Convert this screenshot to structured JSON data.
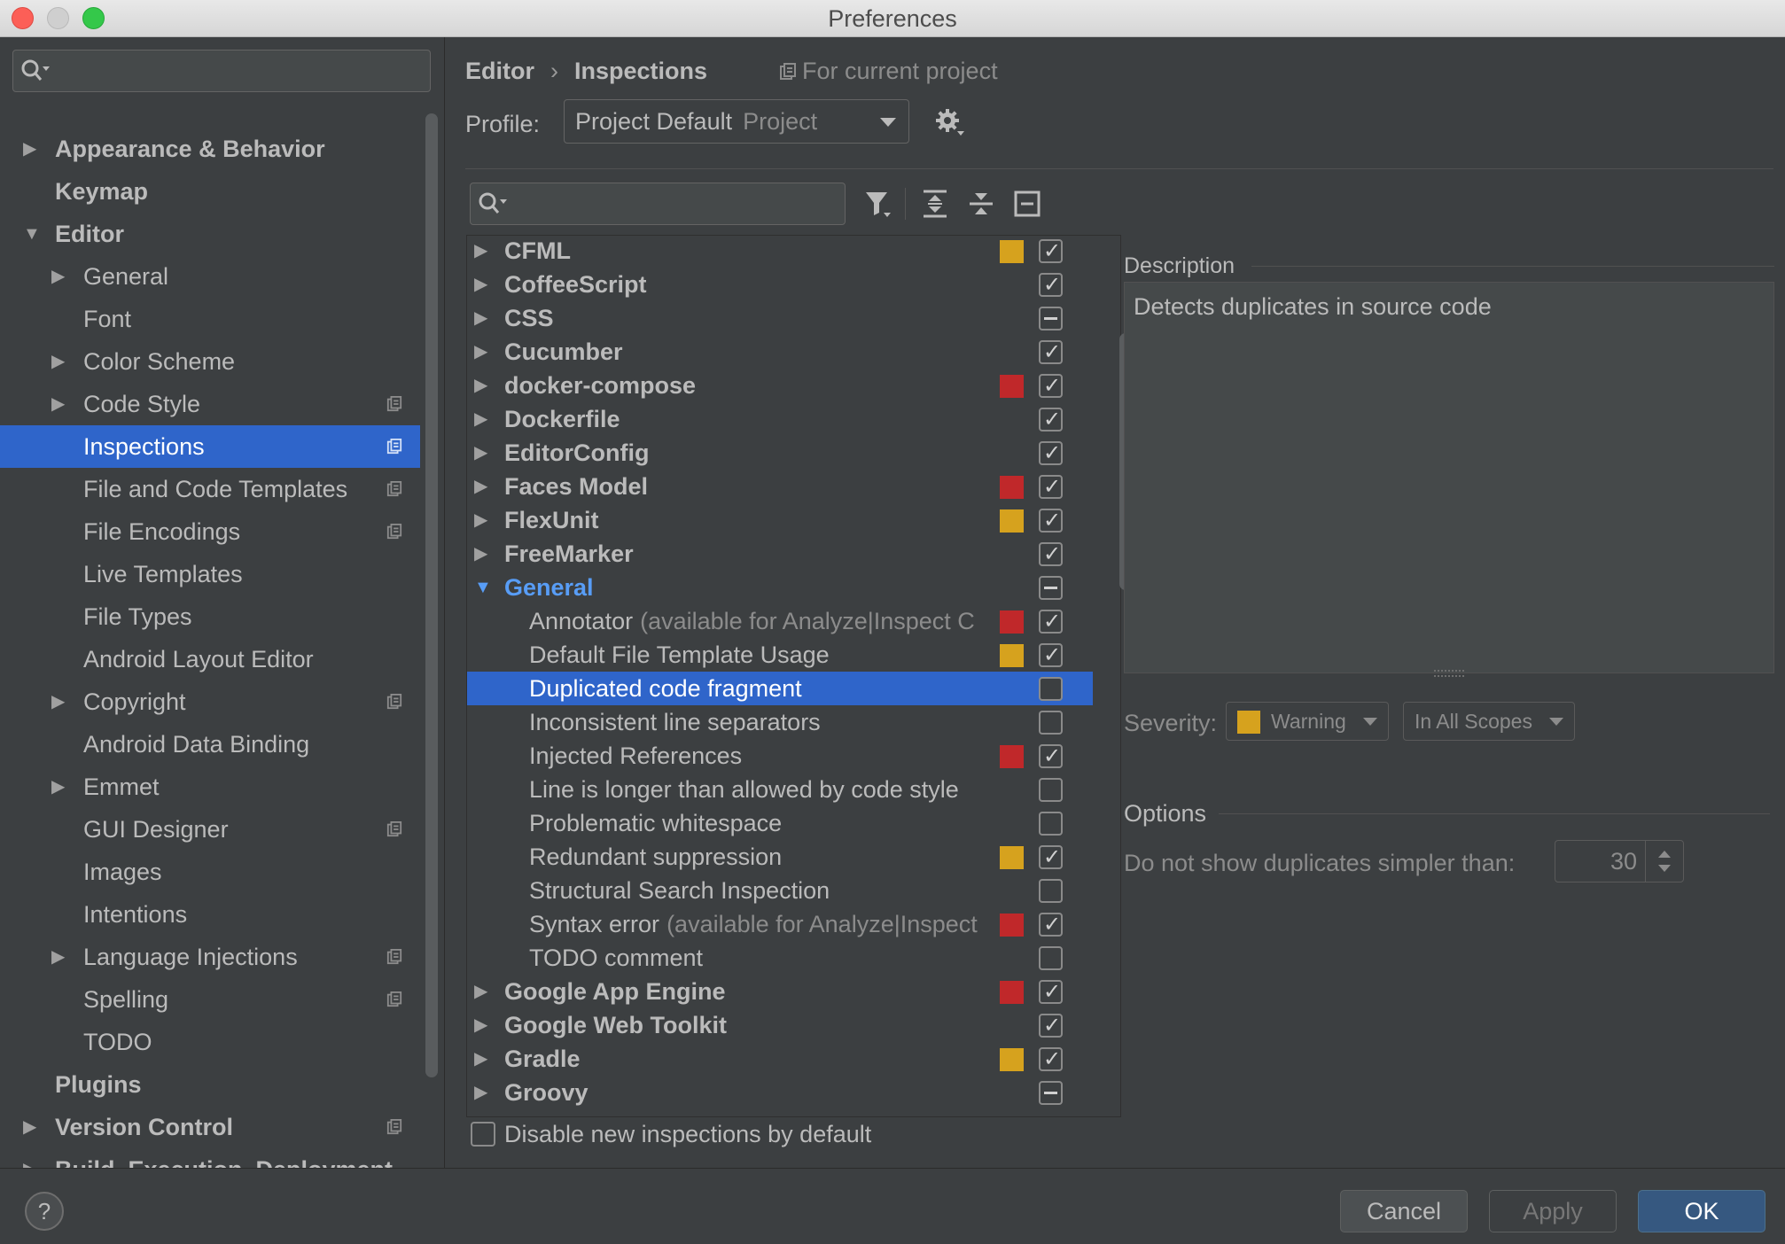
{
  "window": {
    "title": "Preferences"
  },
  "sidebar": {
    "items": [
      {
        "label": "Appearance & Behavior",
        "level": 0,
        "arrow": "right",
        "project": false
      },
      {
        "label": "Keymap",
        "level": 0,
        "arrow": "none",
        "project": false
      },
      {
        "label": "Editor",
        "level": 0,
        "arrow": "down",
        "project": false
      },
      {
        "label": "General",
        "level": 1,
        "arrow": "right",
        "project": false
      },
      {
        "label": "Font",
        "level": 1,
        "arrow": "none",
        "project": false
      },
      {
        "label": "Color Scheme",
        "level": 1,
        "arrow": "right",
        "project": false
      },
      {
        "label": "Code Style",
        "level": 1,
        "arrow": "right",
        "project": true
      },
      {
        "label": "Inspections",
        "level": 1,
        "arrow": "none",
        "project": true,
        "selected": true
      },
      {
        "label": "File and Code Templates",
        "level": 1,
        "arrow": "none",
        "project": true
      },
      {
        "label": "File Encodings",
        "level": 1,
        "arrow": "none",
        "project": true
      },
      {
        "label": "Live Templates",
        "level": 1,
        "arrow": "none",
        "project": false
      },
      {
        "label": "File Types",
        "level": 1,
        "arrow": "none",
        "project": false
      },
      {
        "label": "Android Layout Editor",
        "level": 1,
        "arrow": "none",
        "project": false
      },
      {
        "label": "Copyright",
        "level": 1,
        "arrow": "right",
        "project": true
      },
      {
        "label": "Android Data Binding",
        "level": 1,
        "arrow": "none",
        "project": false
      },
      {
        "label": "Emmet",
        "level": 1,
        "arrow": "right",
        "project": false
      },
      {
        "label": "GUI Designer",
        "level": 1,
        "arrow": "none",
        "project": true
      },
      {
        "label": "Images",
        "level": 1,
        "arrow": "none",
        "project": false
      },
      {
        "label": "Intentions",
        "level": 1,
        "arrow": "none",
        "project": false
      },
      {
        "label": "Language Injections",
        "level": 1,
        "arrow": "right",
        "project": true
      },
      {
        "label": "Spelling",
        "level": 1,
        "arrow": "none",
        "project": true
      },
      {
        "label": "TODO",
        "level": 1,
        "arrow": "none",
        "project": false
      },
      {
        "label": "Plugins",
        "level": 0,
        "arrow": "none",
        "project": false
      },
      {
        "label": "Version Control",
        "level": 0,
        "arrow": "right",
        "project": true
      },
      {
        "label": "Build, Execution, Deployment",
        "level": 0,
        "arrow": "right",
        "project": false
      }
    ]
  },
  "header": {
    "breadcrumb": [
      "Editor",
      "Inspections"
    ],
    "breadcrumb_sep": "›",
    "scope_note": "For current project",
    "profile_label": "Profile:",
    "profile_value": "Project Default",
    "profile_sub": "Project"
  },
  "inspections": [
    {
      "label": "CFML",
      "type": "category",
      "arrow": "right",
      "severity": "warning",
      "state": "checked"
    },
    {
      "label": "CoffeeScript",
      "type": "category",
      "arrow": "right",
      "severity": "",
      "state": "checked"
    },
    {
      "label": "CSS",
      "type": "category",
      "arrow": "right",
      "severity": "",
      "state": "mixed"
    },
    {
      "label": "Cucumber",
      "type": "category",
      "arrow": "right",
      "severity": "",
      "state": "checked"
    },
    {
      "label": "docker-compose",
      "type": "category",
      "arrow": "right",
      "severity": "error",
      "state": "checked"
    },
    {
      "label": "Dockerfile",
      "type": "category",
      "arrow": "right",
      "severity": "",
      "state": "checked"
    },
    {
      "label": "EditorConfig",
      "type": "category",
      "arrow": "right",
      "severity": "",
      "state": "checked"
    },
    {
      "label": "Faces Model",
      "type": "category",
      "arrow": "right",
      "severity": "error",
      "state": "checked"
    },
    {
      "label": "FlexUnit",
      "type": "category",
      "arrow": "right",
      "severity": "warning",
      "state": "checked"
    },
    {
      "label": "FreeMarker",
      "type": "category",
      "arrow": "right",
      "severity": "",
      "state": "checked"
    },
    {
      "label": "General",
      "type": "category",
      "arrow": "down",
      "severity": "",
      "state": "mixed",
      "expanded": true
    },
    {
      "label": "Annotator",
      "note": "(available for Analyze|Inspect C",
      "type": "item",
      "severity": "error",
      "state": "checked"
    },
    {
      "label": "Default File Template Usage",
      "type": "item",
      "severity": "warning",
      "state": "checked"
    },
    {
      "label": "Duplicated code fragment",
      "type": "item",
      "severity": "",
      "state": "unchecked",
      "selected": true
    },
    {
      "label": "Inconsistent line separators",
      "type": "item",
      "severity": "",
      "state": "unchecked"
    },
    {
      "label": "Injected References",
      "type": "item",
      "severity": "error",
      "state": "checked"
    },
    {
      "label": "Line is longer than allowed by code style",
      "type": "item",
      "severity": "",
      "state": "unchecked"
    },
    {
      "label": "Problematic whitespace",
      "type": "item",
      "severity": "",
      "state": "unchecked"
    },
    {
      "label": "Redundant suppression",
      "type": "item",
      "severity": "warning",
      "state": "checked"
    },
    {
      "label": "Structural Search Inspection",
      "type": "item",
      "severity": "",
      "state": "unchecked"
    },
    {
      "label": "Syntax error",
      "note": "(available for Analyze|Inspect",
      "type": "item",
      "severity": "error",
      "state": "checked"
    },
    {
      "label": "TODO comment",
      "type": "item",
      "severity": "",
      "state": "unchecked"
    },
    {
      "label": "Google App Engine",
      "type": "category",
      "arrow": "right",
      "severity": "error",
      "state": "checked"
    },
    {
      "label": "Google Web Toolkit",
      "type": "category",
      "arrow": "right",
      "severity": "",
      "state": "checked"
    },
    {
      "label": "Gradle",
      "type": "category",
      "arrow": "right",
      "severity": "warning",
      "state": "checked"
    },
    {
      "label": "Groovy",
      "type": "category",
      "arrow": "right",
      "severity": "",
      "state": "mixed"
    }
  ],
  "disable_new_label": "Disable new inspections by default",
  "description": {
    "title": "Description",
    "text": "Detects duplicates in source code"
  },
  "severity": {
    "label": "Severity:",
    "value": "Warning",
    "scope": "In All Scopes"
  },
  "options": {
    "title": "Options",
    "label": "Do not show duplicates simpler than:",
    "value": "30"
  },
  "footer": {
    "help": "?",
    "cancel": "Cancel",
    "apply": "Apply",
    "ok": "OK"
  },
  "colors": {
    "warning": "#d6a21e",
    "error": "#c0282a",
    "selection": "#2f65ca",
    "link_blue": "#589df6"
  },
  "icons": {
    "search": "magnifier-icon",
    "filter": "filter-icon",
    "expand_all": "expand-all-icon",
    "collapse_all": "collapse-all-icon",
    "reset": "reset-icon",
    "gear": "gear-icon",
    "project_scope": "project-scope-icon"
  }
}
